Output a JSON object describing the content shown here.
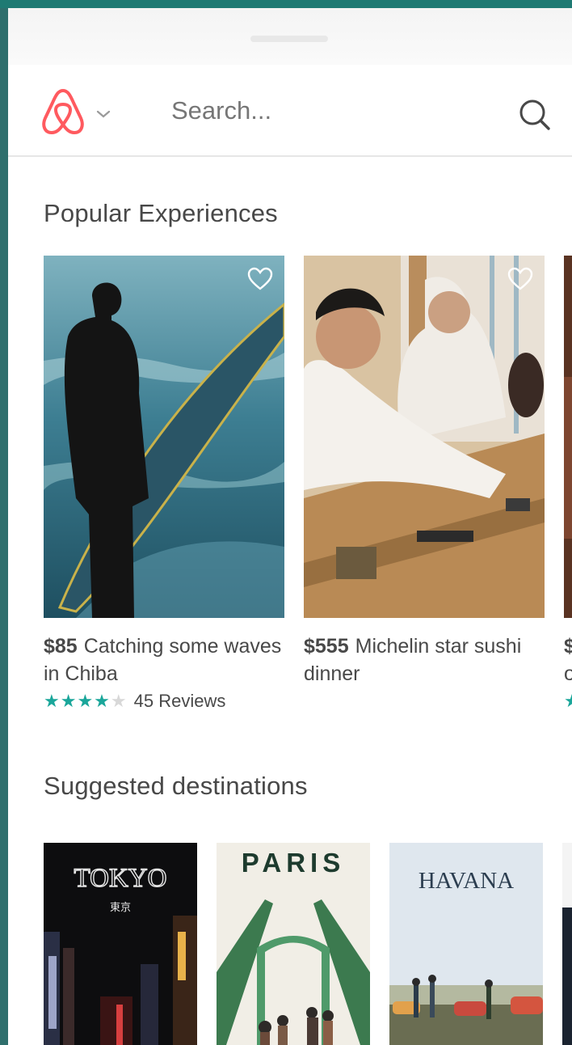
{
  "colors": {
    "accent": "#1aa69a",
    "brand": "#ff5a5f",
    "text": "#484848",
    "frame": "#2f6f6d"
  },
  "header": {
    "logo_icon": "airbnb-logo-icon",
    "search_placeholder": "Search..."
  },
  "experiences": {
    "title": "Popular Experiences",
    "items": [
      {
        "price": "$85",
        "title": "Catching some waves in Chiba",
        "rating": 4,
        "reviews": "45 Reviews"
      },
      {
        "price": "$555",
        "title": "Michelin star sushi dinner"
      },
      {
        "price": "$",
        "title": "o"
      }
    ]
  },
  "destinations": {
    "title": "Suggested destinations",
    "items": [
      {
        "label": "TOKYO",
        "sub": "東京"
      },
      {
        "label": "PARIS"
      },
      {
        "label": "HAVANA"
      }
    ]
  }
}
